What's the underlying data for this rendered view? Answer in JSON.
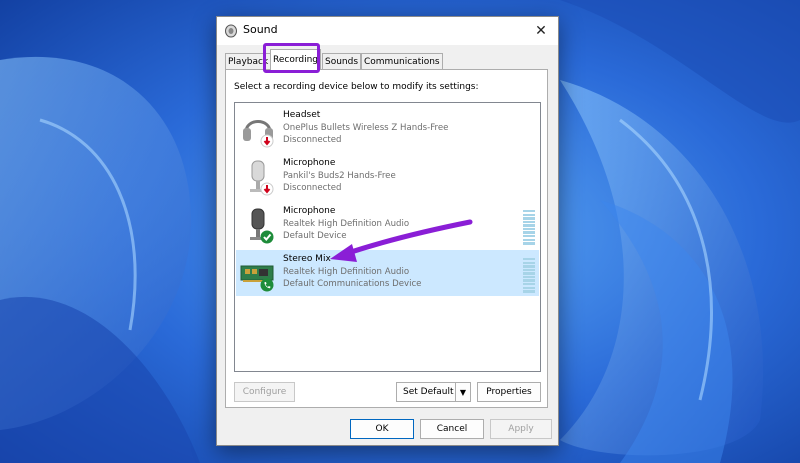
{
  "window": {
    "title": "Sound",
    "close_glyph": "✕",
    "icon": "speaker-icon"
  },
  "tabs": [
    {
      "label": "Playback",
      "active": false
    },
    {
      "label": "Recording",
      "active": true
    },
    {
      "label": "Sounds",
      "active": false
    },
    {
      "label": "Communications",
      "active": false
    }
  ],
  "instruction": "Select a recording device below to modify its settings:",
  "devices": [
    {
      "name": "Headset",
      "description": "OnePlus Bullets Wireless Z Hands-Free",
      "status": "Disconnected",
      "icon": "headset-icon",
      "badge": "disconnected-badge",
      "selected": false
    },
    {
      "name": "Microphone",
      "description": "Pankil's Buds2 Hands-Free",
      "status": "Disconnected",
      "icon": "microphone-icon",
      "badge": "disconnected-badge",
      "selected": false
    },
    {
      "name": "Microphone",
      "description": "Realtek High Definition Audio",
      "status": "Default Device",
      "icon": "microphone-icon",
      "badge": "default-check-badge",
      "selected": false
    },
    {
      "name": "Stereo Mix",
      "description": "Realtek High Definition Audio",
      "status": "Default Communications Device",
      "icon": "sound-card-icon",
      "badge": "communications-phone-badge",
      "selected": true
    }
  ],
  "buttons": {
    "configure": "Configure",
    "set_default": "Set Default",
    "properties": "Properties",
    "ok": "OK",
    "cancel": "Cancel",
    "apply": "Apply"
  },
  "colors": {
    "highlight": "#8a1ed6",
    "selection": "#cce8ff",
    "accent": "#0067c0"
  }
}
